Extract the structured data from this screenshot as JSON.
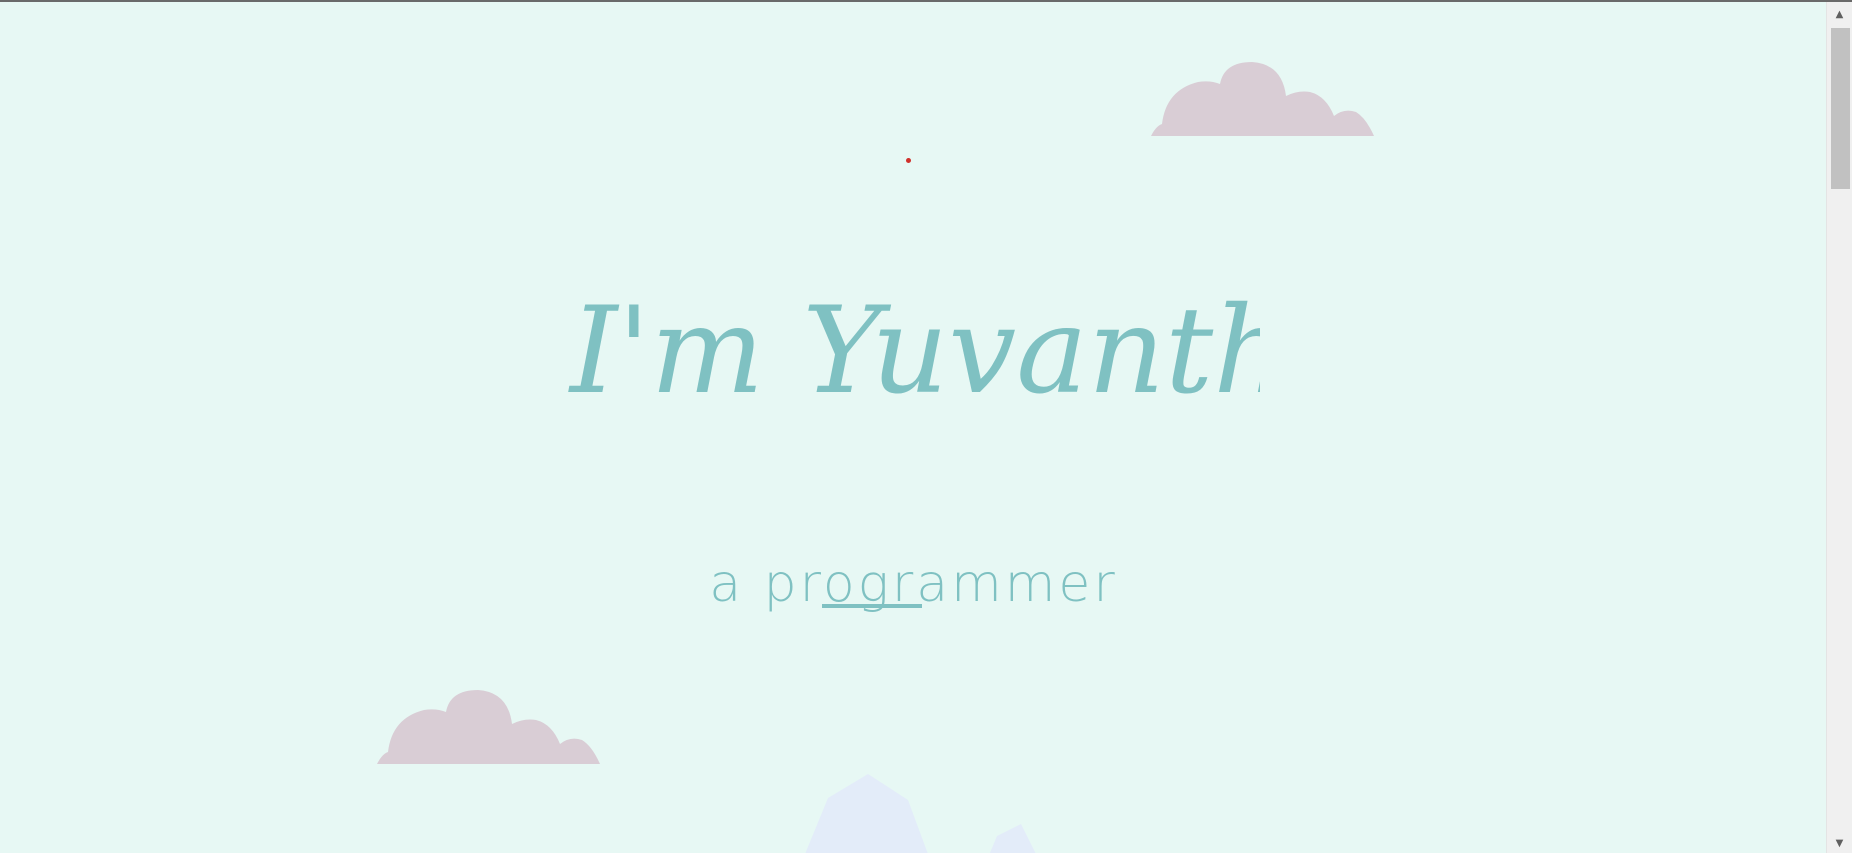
{
  "hero": {
    "headline": "I'm Yuvanth.",
    "subtitle_prefix": "a ",
    "subtitle_word": "programmer"
  },
  "colors": {
    "background": "#e7f8f4",
    "accent": "#7fc1c2",
    "cloud": "#d9cdd5",
    "mountain": "#e3ecf9",
    "dot": "#d0302a"
  },
  "icons": {
    "scroll_up": "▲",
    "scroll_down": "▼"
  }
}
